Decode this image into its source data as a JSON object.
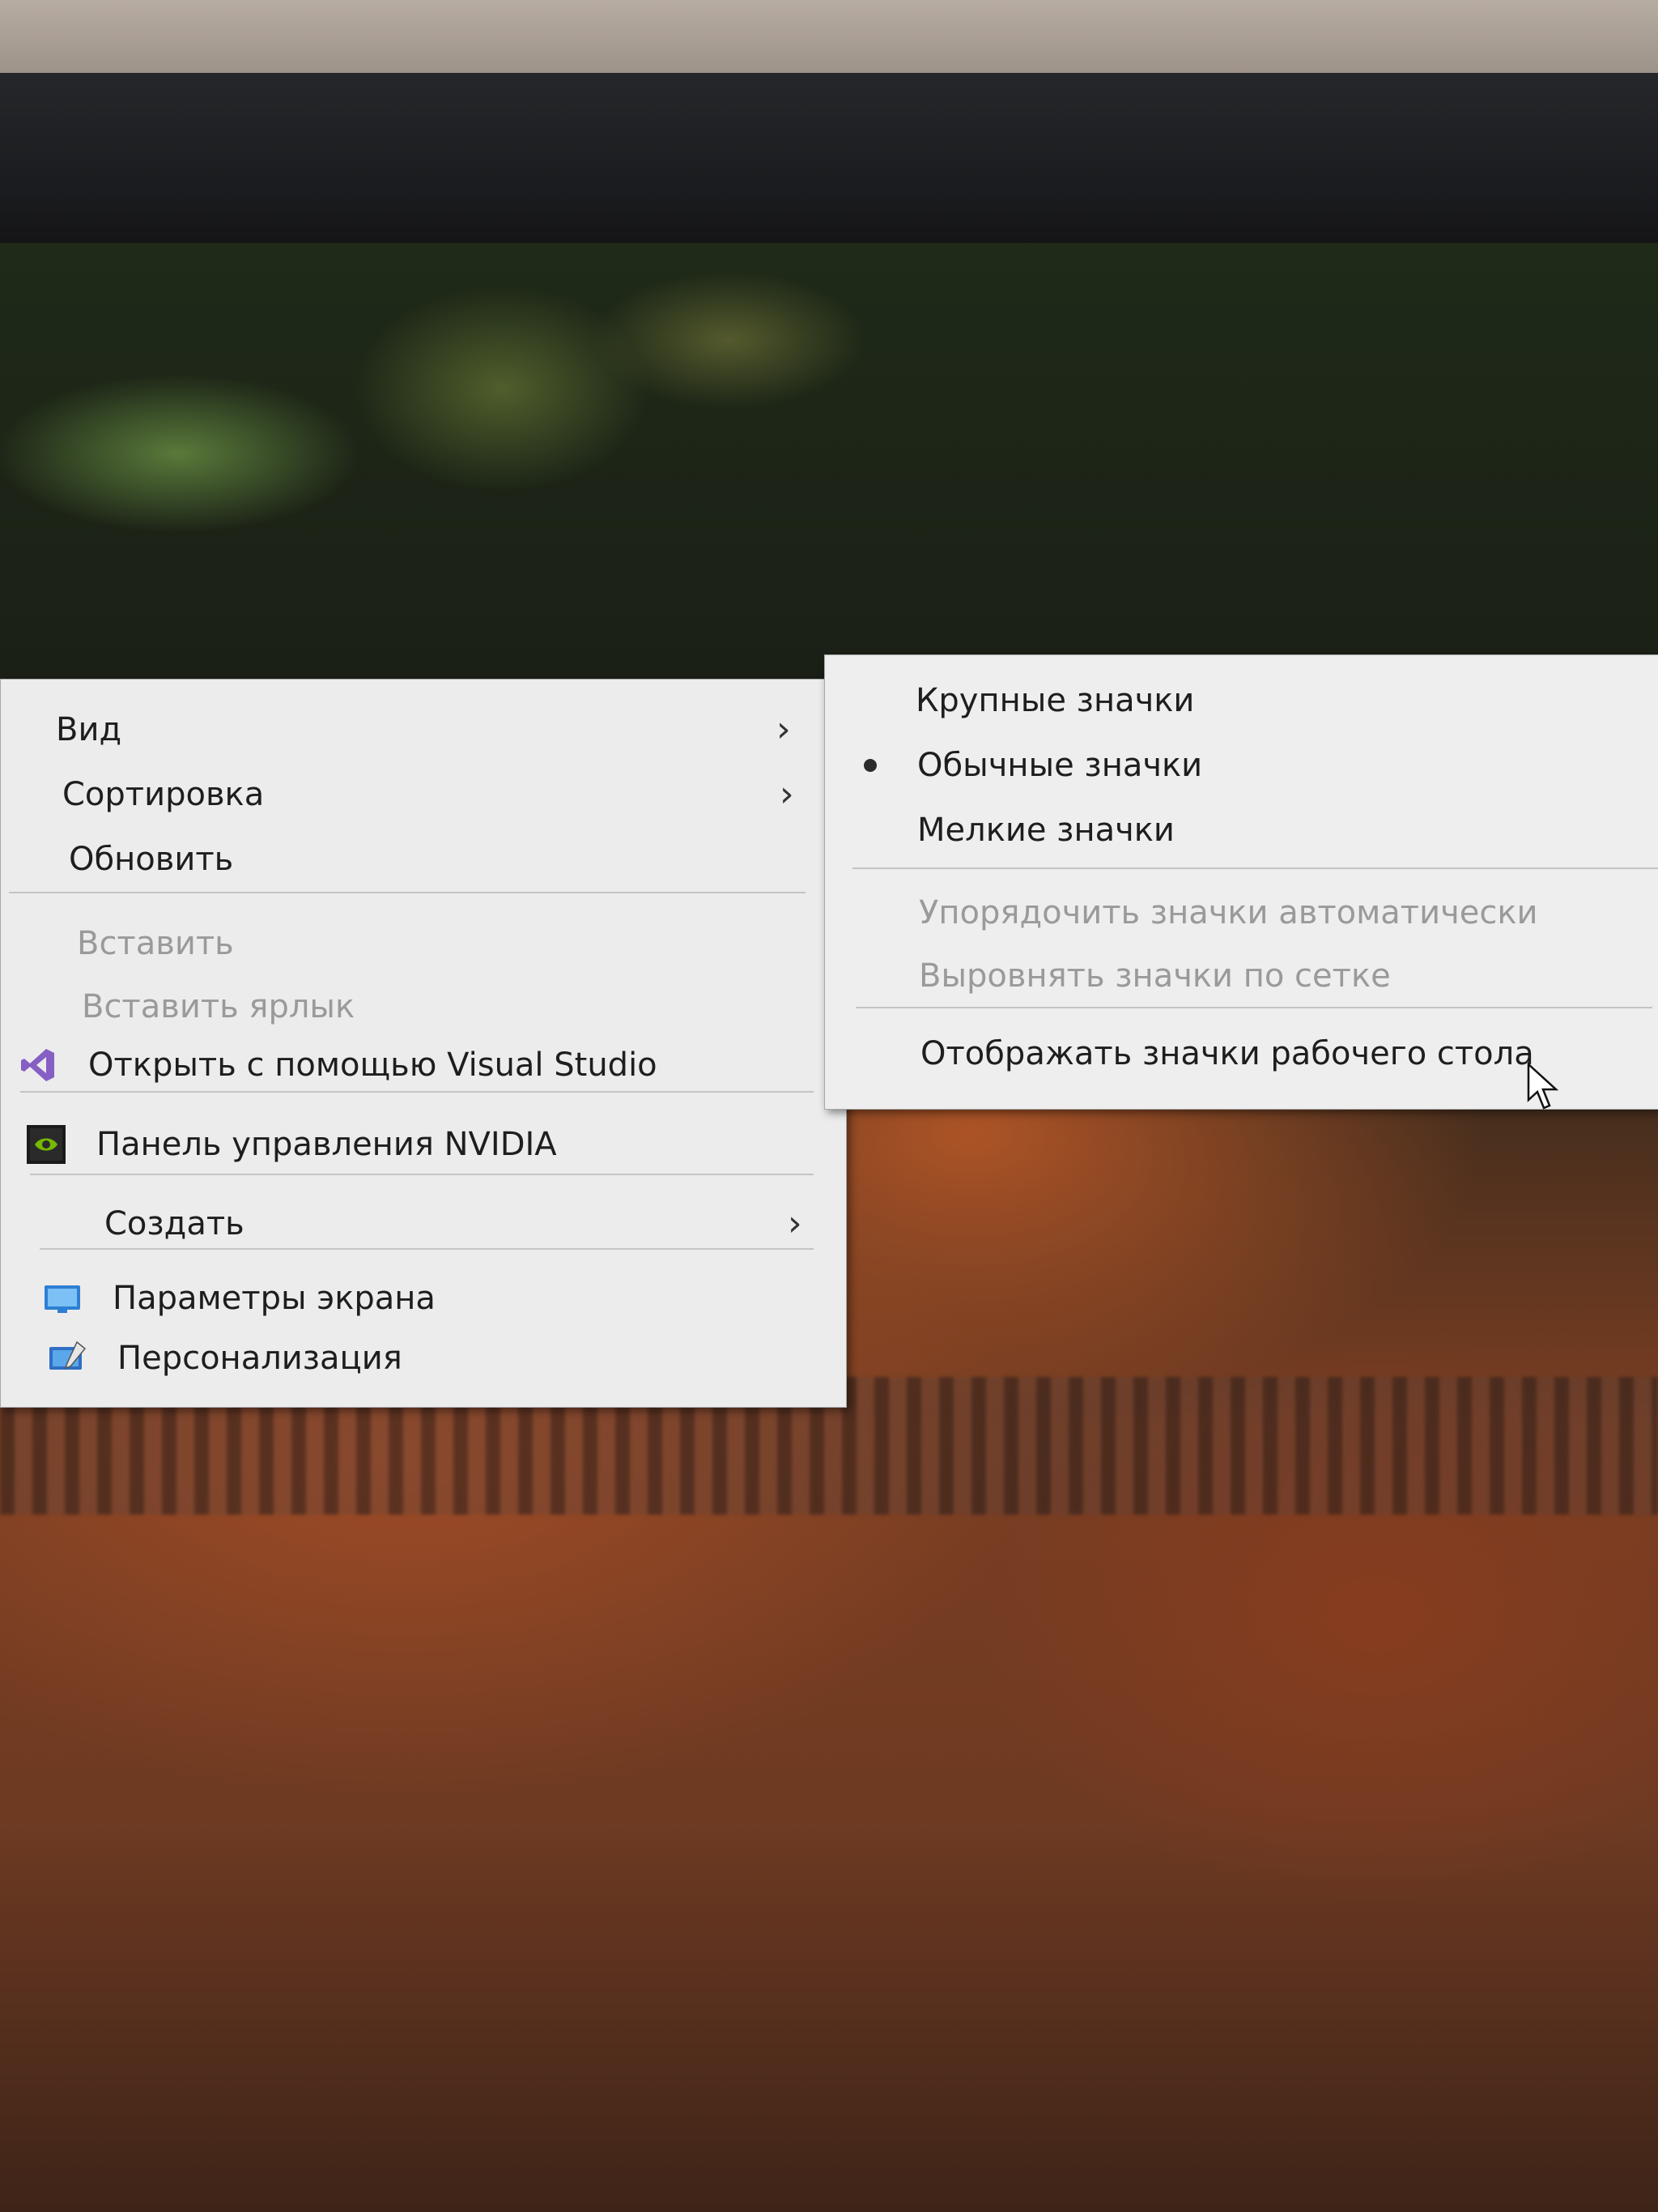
{
  "context_menu": {
    "items": [
      {
        "label": "Вид"
      },
      {
        "label": "Сортировка"
      },
      {
        "label": "Обновить"
      },
      {
        "label": "Вставить"
      },
      {
        "label": "Вставить ярлык"
      },
      {
        "label": "Открыть с помощью Visual Studio",
        "icon": "visual-studio-icon"
      },
      {
        "label": "Панель управления NVIDIA",
        "icon": "nvidia-icon"
      },
      {
        "label": "Создать"
      },
      {
        "label": "Параметры экрана",
        "icon": "display-icon"
      },
      {
        "label": "Персонализация",
        "icon": "personalization-icon"
      }
    ]
  },
  "view_submenu": {
    "items": [
      {
        "label": "Крупные значки"
      },
      {
        "label": "Обычные значки",
        "selected": true
      },
      {
        "label": "Мелкие значки"
      },
      {
        "label": "Упорядочить значки автоматически",
        "enabled": false
      },
      {
        "label": "Выровнять значки по сетке",
        "enabled": false
      },
      {
        "label": "Отображать значки рабочего стола"
      }
    ]
  },
  "colors": {
    "menu_background": "#ececec",
    "menu_text": "#1e1e1e",
    "disabled_text": "#9a9a9a",
    "visual_studio_purple": "#865fc5",
    "nvidia_green": "#76b900"
  }
}
